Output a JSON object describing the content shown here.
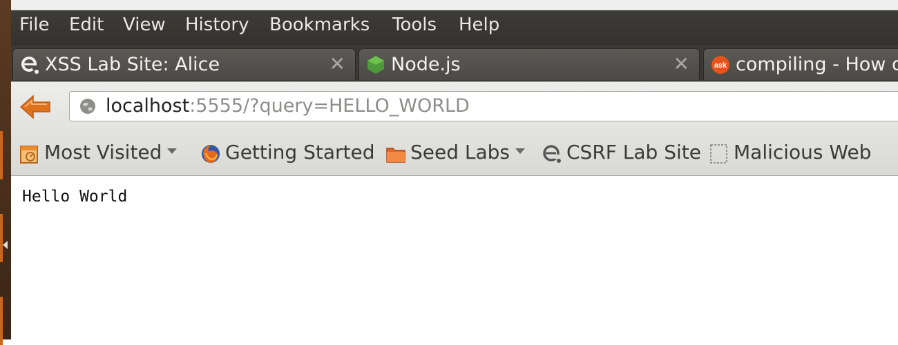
{
  "menubar": {
    "items": [
      "File",
      "Edit",
      "View",
      "History",
      "Bookmarks",
      "Tools",
      "Help"
    ]
  },
  "tabs": [
    {
      "label": "XSS Lab Site: Alice",
      "icon": "elgg-icon",
      "close": "✕"
    },
    {
      "label": "Node.js",
      "icon": "nodejs-icon",
      "close": "✕"
    },
    {
      "label": "compiling - How d",
      "icon": "ask-icon",
      "icon_text": "ask"
    }
  ],
  "navigation": {
    "url_host": "localhost",
    "url_rest": ":5555/?query=HELLO_WORLD"
  },
  "bookmarks": [
    {
      "label": "Most Visited",
      "icon": "most-visited-icon",
      "dropdown": true
    },
    {
      "label": "Getting Started",
      "icon": "firefox-icon",
      "dropdown": false
    },
    {
      "label": "Seed Labs",
      "icon": "folder-icon",
      "dropdown": true
    },
    {
      "label": "CSRF Lab Site",
      "icon": "elgg-icon",
      "dropdown": false
    },
    {
      "label": "Malicious Web",
      "icon": "blank-page-icon",
      "dropdown": false
    }
  ],
  "page": {
    "body_text": "Hello World"
  },
  "colors": {
    "back_arrow": "#e0721e",
    "launcher_accent": "#c9661c",
    "node_green": "#4e9a3a",
    "ask_orange": "#e4541c"
  }
}
